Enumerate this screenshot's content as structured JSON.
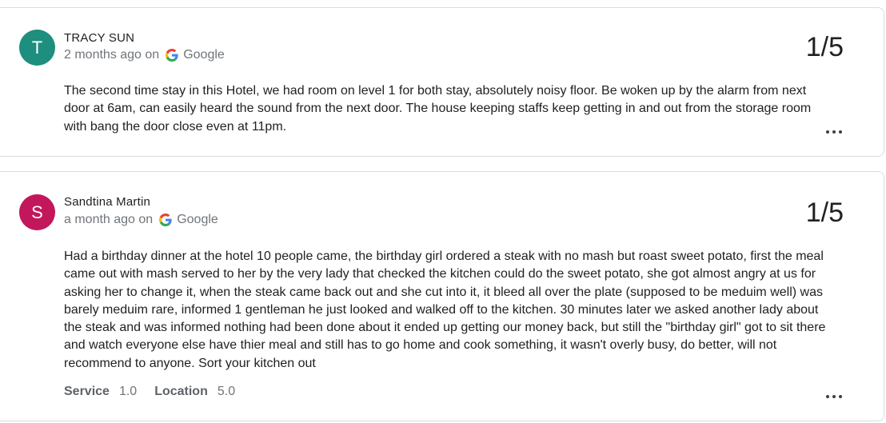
{
  "reviews": [
    {
      "avatar_letter": "T",
      "avatar_color": "#1e8e7e",
      "name": "TRACY SUN",
      "time": "2 months ago on",
      "source": "Google",
      "rating": "1/5",
      "text": "The second time stay in this Hotel, we had room on level 1 for both stay, absolutely noisy floor. Be woken up by the alarm from next door at 6am, can easily heard the sound from the next door. The house keeping staffs keep getting in and out from the storage room with bang the door close even at 11pm."
    },
    {
      "avatar_letter": "S",
      "avatar_color": "#c2185b",
      "name": "Sandtina Martin",
      "time": "a month ago on",
      "source": "Google",
      "rating": "1/5",
      "text": "Had a birthday dinner at the hotel 10 people came, the birthday girl ordered a steak with no mash but roast sweet potato, first the meal came out with mash served to her by the very lady that checked the kitchen could do the sweet potato, she got almost angry at us for asking her to change it, when the steak came back out and she cut into it, it bleed all over the plate (supposed to be meduim well) was barely meduim rare, informed 1 gentleman he just looked and walked off to the kitchen. 30 minutes later we asked another lady about the steak and was informed nothing had been done about it ended up getting our money back, but still the \"birthday girl\" got to sit there and watch everyone else have thier meal and still has to go home and cook something, it wasn't overly busy, do better, will not recommend to anyone. Sort your kitchen out",
      "subratings": [
        {
          "label": "Service",
          "value": "1.0"
        },
        {
          "label": "Location",
          "value": "5.0"
        }
      ]
    }
  ],
  "icons": {
    "source_icon": "google-g-icon",
    "more_icon": "more-options-icon"
  }
}
